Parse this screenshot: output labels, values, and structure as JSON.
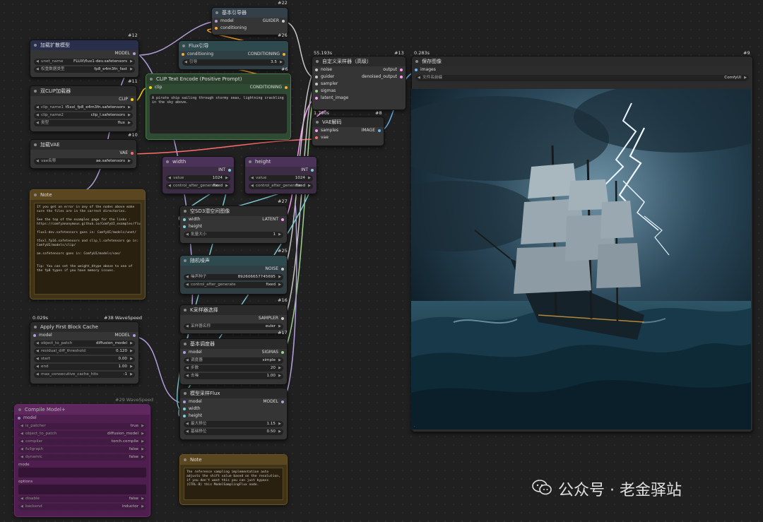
{
  "nodes": {
    "guider": {
      "title": "基本引导器",
      "id": "#22",
      "inputs": [
        "model",
        "conditioning"
      ],
      "output": "GUIDER"
    },
    "flux_guidance": {
      "title": "Flux引导",
      "id": "#26",
      "input": "conditioning",
      "output": "CONDITIONING",
      "widget_name": "引导",
      "widget_value": "3.5",
      "sub_id": "#6"
    },
    "unet_loader": {
      "title": "加载扩散模型",
      "id": "#12",
      "output": "MODEL",
      "widgets": [
        {
          "name": "unet_name",
          "value": "FLUX\\flux1-dev.safetensors"
        },
        {
          "name": "权重数据类型",
          "value": "fp8_e4m3fn_fast"
        }
      ]
    },
    "dual_clip": {
      "title": "双CLIP加载器",
      "id": "#11",
      "output": "CLIP",
      "widgets": [
        {
          "name": "clip_name1",
          "value": "t5xxl_fp8_e4m3fn.safetensors"
        },
        {
          "name": "clip_name2",
          "value": "clip_l.safetensors"
        },
        {
          "name": "类型",
          "value": "flux"
        }
      ],
      "sub_id": "#10"
    },
    "clip_encode": {
      "title": "CLIP Text Encode (Positive Prompt)",
      "input": "clip",
      "output": "CONDITIONING",
      "text": "A pirate ship sailing through stormy seas, lightning crackling in the sky above."
    },
    "vae_loader": {
      "title": "加载VAE",
      "output": "VAE",
      "widget_name": "vae名称",
      "widget_value": "ae.safetensors"
    },
    "sampler_adv": {
      "title": "自定义采样器（高级）",
      "id": "#13",
      "timing": "55.193s",
      "inputs": [
        "noise",
        "guider",
        "sampler",
        "sigmas",
        "latent_image"
      ],
      "outputs": [
        "output",
        "denoised_output"
      ]
    },
    "vae_decode": {
      "title": "VAE解码",
      "id": "#8",
      "timing": "1.790s",
      "inputs": [
        "samples",
        "vae"
      ],
      "output": "IMAGE"
    },
    "save_image": {
      "title": "保存图像",
      "id": "#9",
      "timing": "0.283s",
      "input": "images",
      "widget_name": "文件名前缀",
      "widget_value": "ComfyUI"
    },
    "width": {
      "title": "width",
      "output": "INT",
      "widgets": [
        {
          "name": "value",
          "value": "1024"
        },
        {
          "name": "control_after_generate",
          "value": "fixed"
        }
      ]
    },
    "height": {
      "title": "height",
      "output": "INT",
      "widgets": [
        {
          "name": "value",
          "value": "1024"
        },
        {
          "name": "control_after_generate",
          "value": "fixed"
        }
      ]
    },
    "empty_latent": {
      "title": "空SD3潜空间图像",
      "id": "#27",
      "inputs": [
        "width",
        "height"
      ],
      "output": "LATENT",
      "widget_name": "批量大小",
      "widget_value": "1",
      "sub_id": "#25"
    },
    "noise": {
      "title": "随机噪声",
      "output": "NOISE",
      "widgets": [
        {
          "name": "噪声种子",
          "value": "892606657745695"
        },
        {
          "name": "control_after_generate",
          "value": "fixed"
        }
      ],
      "sub_id": "#16"
    },
    "ksampler_select": {
      "title": "K采样器选择",
      "output": "SAMPLER",
      "widget_name": "采样器名称",
      "widget_value": "euler",
      "sub_id": "#17"
    },
    "scheduler": {
      "title": "基本调度器",
      "input": "model",
      "output": "SIGMAS",
      "widgets": [
        {
          "name": "调度器",
          "value": "simple"
        },
        {
          "name": "步数",
          "value": "20"
        },
        {
          "name": "去噪",
          "value": "1.00"
        }
      ]
    },
    "model_sampling": {
      "title": "模型采样Flux",
      "inputs": [
        "model",
        "width",
        "height"
      ],
      "output": "MODEL",
      "widgets": [
        {
          "name": "最大移位",
          "value": "1.15"
        },
        {
          "name": "基础移位",
          "value": "0.50"
        }
      ]
    },
    "note1": {
      "title": "Note",
      "text": "If you get an error in any of the nodes above make sure the files are in the correct directories.\n\nSee the top of the examples page for the links : https://comfyanonymous.github.io/ComfyUI_examples/flux/\n\nflux1-dev.safetensors goes in: ComfyUI/models/unet/\n\nt5xxl_fp16.safetensors and clip_l.safetensors go in: ComfyUI/models/clip/\n\nae.safetensors goes in: ComfyUI/models/vae/\n\n\nTip: You can set the weight_dtype above to one of the fp8 types if you have memory issues."
    },
    "note2": {
      "title": "Note",
      "text": "The reference sampling implementation auto adjusts the shift value based on the resolution, if you don't want this you can just bypass (CTRL-B) this ModelSamplingFlux node."
    },
    "fbcache": {
      "title": "Apply First Block Cache",
      "timing": "0.029s",
      "id": "#38 WaveSpeed",
      "input": "model",
      "output": "MODEL",
      "widgets": [
        {
          "name": "object_to_patch",
          "value": "diffusion_model"
        },
        {
          "name": "residual_diff_threshold",
          "value": "0.120"
        },
        {
          "name": "start",
          "value": "0.00"
        },
        {
          "name": "end",
          "value": "1.00"
        },
        {
          "name": "max_consecutive_cache_hits",
          "value": "-1"
        }
      ]
    },
    "compile": {
      "title": "Compile Model+",
      "id": "#29 WaveSpeed",
      "section": "model",
      "widgets": [
        {
          "name": "is_patcher",
          "value": "true"
        },
        {
          "name": "object_to_patch",
          "value": "diffusion_model"
        },
        {
          "name": "compiler",
          "value": "torch.compile"
        },
        {
          "name": "fullgraph",
          "value": "false"
        },
        {
          "name": "dynamic",
          "value": "false"
        }
      ],
      "field1": "mode",
      "field2": "options",
      "widgets2": [
        {
          "name": "disable",
          "value": "false"
        },
        {
          "name": "backend",
          "value": "inductor"
        }
      ]
    }
  },
  "watermark": "公众号 · 老金驿站",
  "colors": {
    "model": "#b39ddb",
    "clip": "#ffd500",
    "vae": "#ff6e6e",
    "conditioning": "#ffa931",
    "latent": "#ff9cf9",
    "int": "#7ecfd6",
    "image": "#64b5f6"
  }
}
